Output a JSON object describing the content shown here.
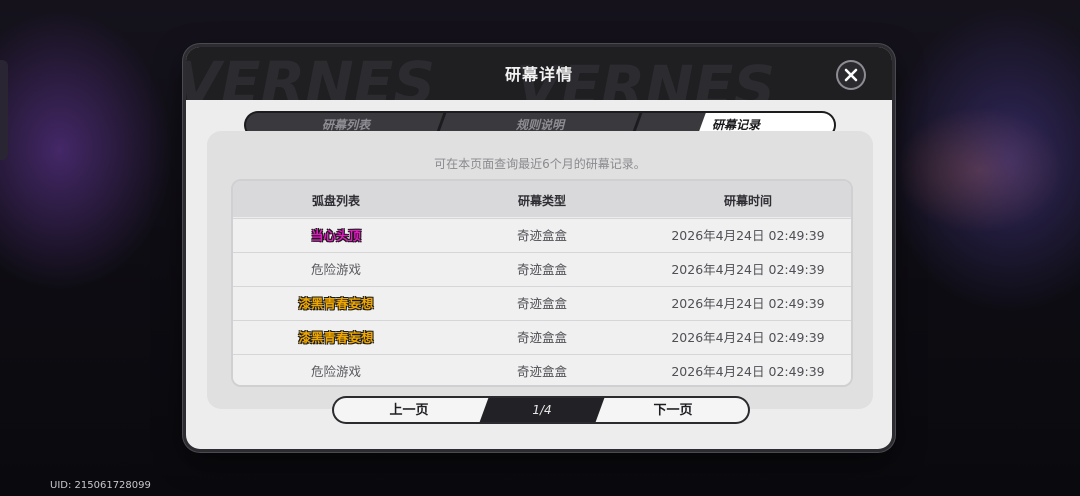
{
  "dialog": {
    "title": "研幕详情",
    "header_watermark": "VERNES",
    "close_icon": "close-icon"
  },
  "tabs": [
    {
      "label": "研幕列表",
      "active": false
    },
    {
      "label": "规则说明",
      "active": false
    },
    {
      "label": "研幕记录",
      "active": true
    }
  ],
  "hint": "可在本页面查询最近6个月的研幕记录。",
  "table": {
    "columns": [
      "弧盘列表",
      "研幕类型",
      "研幕时间"
    ],
    "rows": [
      {
        "name": "当心头顶",
        "type": "奇迹盒盒",
        "time": "2026年4月24日 02:49:39",
        "color": "#e21cc2",
        "highlight": true
      },
      {
        "name": "危险游戏",
        "type": "奇迹盒盒",
        "time": "2026年4月24日 02:49:39",
        "color": "#5a5a60",
        "highlight": false
      },
      {
        "name": "漆黑青春妄想",
        "type": "奇迹盒盒",
        "time": "2026年4月24日 02:49:39",
        "color": "#f0a800",
        "highlight": true
      },
      {
        "name": "漆黑青春妄想",
        "type": "奇迹盒盒",
        "time": "2026年4月24日 02:49:39",
        "color": "#f0a800",
        "highlight": true
      },
      {
        "name": "危险游戏",
        "type": "奇迹盒盒",
        "time": "2026年4月24日 02:49:39",
        "color": "#5a5a60",
        "highlight": false
      }
    ]
  },
  "pager": {
    "prev_label": "上一页",
    "page_indicator": "1/4",
    "next_label": "下一页"
  },
  "uid": "UID: 215061728099"
}
